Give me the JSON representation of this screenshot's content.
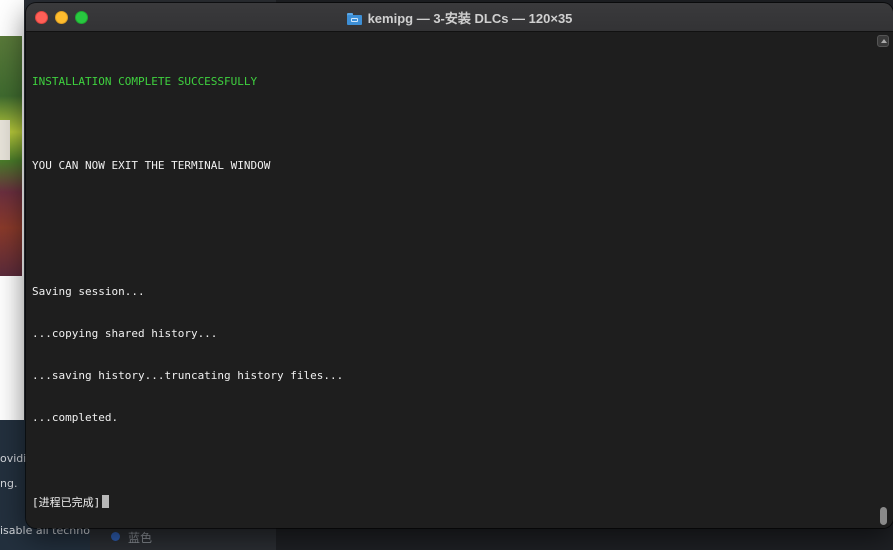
{
  "window": {
    "title": "kemipg — 3-安装 DLCs — 120×35",
    "title_icon": "folder-icon"
  },
  "terminal": {
    "lines": [
      "INSTALLATION COMPLETE SUCCESSFULLY",
      "",
      "YOU CAN NOW EXIT THE TERMINAL WINDOW",
      "",
      "",
      "Saving session...",
      "...copying shared history...",
      "...saving history...truncating history files...",
      "...completed.",
      "",
      "[进程已完成]"
    ],
    "colors": {
      "success": "#3fd13f",
      "text": "#f0f0f0",
      "background": "#1e1e1e"
    }
  },
  "background": {
    "frag_1": "ovidi",
    "frag_2": "ng.",
    "frag_3": "isable all techno",
    "frag_blue_label": "蓝色"
  }
}
